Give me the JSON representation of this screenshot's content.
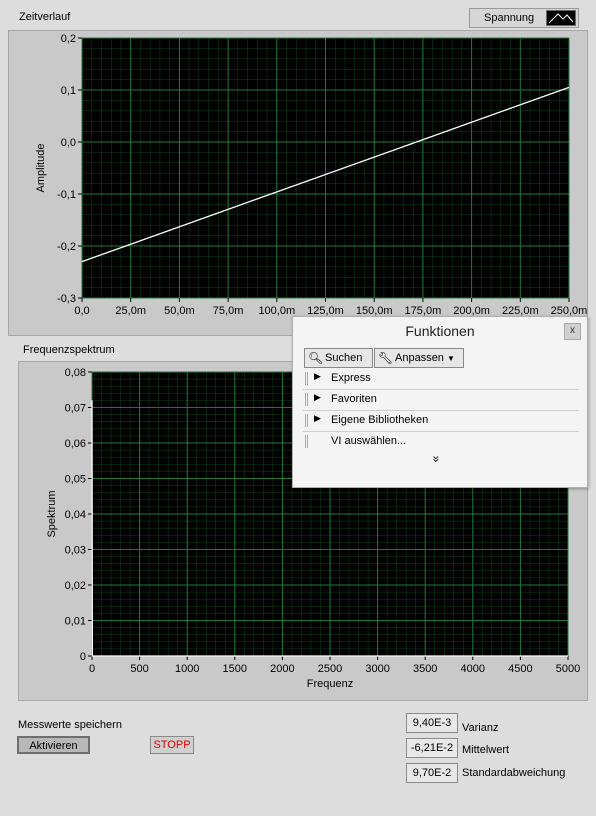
{
  "time_graph": {
    "caption": "Zeitverlauf",
    "plot_name": "Spannung",
    "ylabel": "Amplitude",
    "yticks": [
      "0,2",
      "0,1",
      "0,0",
      "-0,1",
      "-0,2",
      "-0,3"
    ],
    "xticks": [
      "0,0",
      "25,0m",
      "50,0m",
      "75,0m",
      "100,0m",
      "125,0m",
      "150,0m",
      "175,0m",
      "200,0m",
      "225,0m",
      "250,0m"
    ],
    "plot_bg": "#000000",
    "grid_color": "#1f7a3a",
    "trace_color": "#ffffff"
  },
  "spectrum_graph": {
    "caption": "Frequenzspektrum",
    "ylabel": "Spektrum",
    "xlabel": "Frequenz",
    "yticks": [
      "0,08",
      "0,07",
      "0,06",
      "0,05",
      "0,04",
      "0,03",
      "0,02",
      "0,01",
      "0"
    ],
    "xticks": [
      "0",
      "500",
      "1000",
      "1500",
      "2000",
      "2500",
      "3000",
      "3500",
      "4000",
      "4500",
      "5000"
    ]
  },
  "chart_data": [
    {
      "type": "line",
      "title": "Zeitverlauf",
      "ylabel": "Amplitude",
      "xlabel": "",
      "xlim": [
        0,
        0.25
      ],
      "ylim": [
        -0.3,
        0.2
      ],
      "grid": true,
      "series": [
        {
          "name": "Spannung",
          "x": [
            0,
            0.25
          ],
          "y": [
            -0.23,
            0.105
          ]
        }
      ]
    },
    {
      "type": "line",
      "title": "Frequenzspektrum",
      "ylabel": "Spektrum",
      "xlabel": "Frequenz",
      "xlim": [
        0,
        5000
      ],
      "ylim": [
        0,
        0.08
      ],
      "grid": true,
      "series": [
        {
          "x": [
            0,
            4,
            8,
            5000
          ],
          "y": [
            0.072,
            0.0,
            0.0,
            0.0
          ]
        }
      ]
    }
  ],
  "palette": {
    "title": "Funktionen",
    "close": "x",
    "search_label": "Suchen",
    "customize_label": "Anpassen",
    "items": [
      "Express",
      "Favoriten",
      "Eigene Bibliotheken"
    ],
    "select_vi": "VI auswählen...",
    "more": "»"
  },
  "controls": {
    "save_label": "Messwerte speichern",
    "activate_label": "Aktivieren",
    "stop_label": "STOPP"
  },
  "indicators": [
    {
      "value": "9,40E-3",
      "label": "Varianz"
    },
    {
      "value": "-6,21E-2",
      "label": "Mittelwert"
    },
    {
      "value": "9,70E-2",
      "label": "Standardabweichung"
    }
  ]
}
